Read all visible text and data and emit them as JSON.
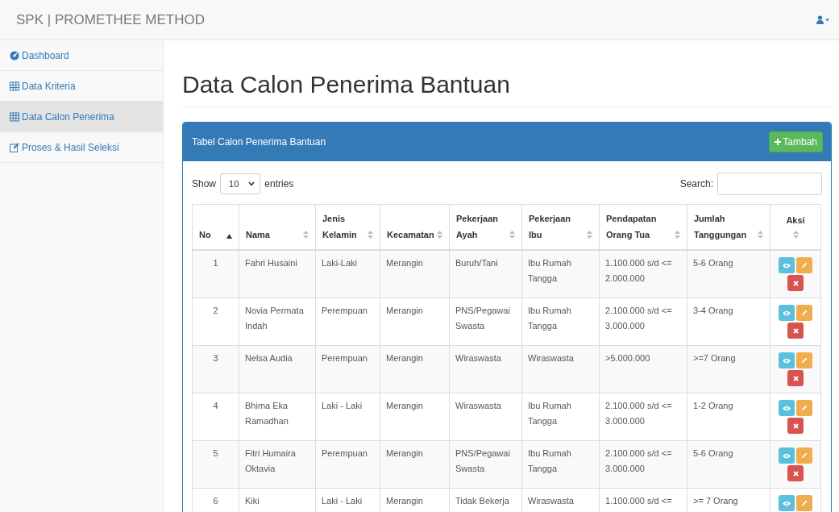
{
  "navbar": {
    "brand": "SPK | PROMETHEE METHOD"
  },
  "sidebar": {
    "items": [
      {
        "label": "Dashboard",
        "selected": false
      },
      {
        "label": "Data Kriteria",
        "selected": false
      },
      {
        "label": "Data Calon Penerima",
        "selected": true
      },
      {
        "label": "Proses & Hasil Seleksi",
        "selected": false
      }
    ]
  },
  "page": {
    "title": "Data Calon Penerima Bantuan"
  },
  "panel": {
    "title": "Tabel Calon Penerima Bantuan",
    "add_button": "Tambah"
  },
  "controls": {
    "show_label": "Show",
    "page_size": "10",
    "entries_label": "entries",
    "search_label": "Search:"
  },
  "table": {
    "columns": [
      {
        "label": "No",
        "sorted": true
      },
      {
        "label": "Nama",
        "sorted": false
      },
      {
        "label": "Jenis Kelamin",
        "sorted": false
      },
      {
        "label": "Kecamatan",
        "sorted": false
      },
      {
        "label": "Pekerjaan Ayah",
        "sorted": false
      },
      {
        "label": "Pekerjaan Ibu",
        "sorted": false
      },
      {
        "label": "Pendapatan Orang Tua",
        "sorted": false
      },
      {
        "label": "Jumlah Tanggungan",
        "sorted": false
      },
      {
        "label": "Aksi",
        "sorted": false
      }
    ],
    "rows": [
      {
        "cells": [
          "1",
          "Fahri Husaini",
          "Laki-Laki",
          "Merangin",
          "Buruh/Tani",
          "Ibu Rumah Tangga",
          "1.100.000 s/d <= 2.000.000",
          "5-6 Orang"
        ]
      },
      {
        "cells": [
          "2",
          "Novia Permata Indah",
          "Perempuan",
          "Merangin",
          "PNS/Pegawai Swasta",
          "Ibu Rumah Tangga",
          "2.100.000 s/d <= 3.000.000",
          "3-4 Orang"
        ]
      },
      {
        "cells": [
          "3",
          "Nelsa Audia",
          "Perempuan",
          "Merangin",
          "Wiraswasta",
          "Wiraswasta",
          ">5.000.000",
          ">=7 Orang"
        ]
      },
      {
        "cells": [
          "4",
          "Bhima Eka Ramadhan",
          "Laki - Laki",
          "Merangin",
          "Wiraswasta",
          "Ibu Rumah Tangga",
          "2.100.000 s/d <= 3.000.000",
          "1-2 Orang"
        ]
      },
      {
        "cells": [
          "5",
          "Fitri Humaira Oktavia",
          "Perempuan",
          "Merangin",
          "PNS/Pegawai Swasta",
          "Ibu Rumah Tangga",
          "2.100.000 s/d <= 3.000.000",
          "5-6 Orang"
        ]
      },
      {
        "cells": [
          "6",
          "Kiki",
          "Laki - Laki",
          "Merangin",
          "Tidak Bekerja",
          "Wiraswasta",
          "1.100.000 s/d <=",
          ">= 7 Orang"
        ]
      }
    ]
  }
}
